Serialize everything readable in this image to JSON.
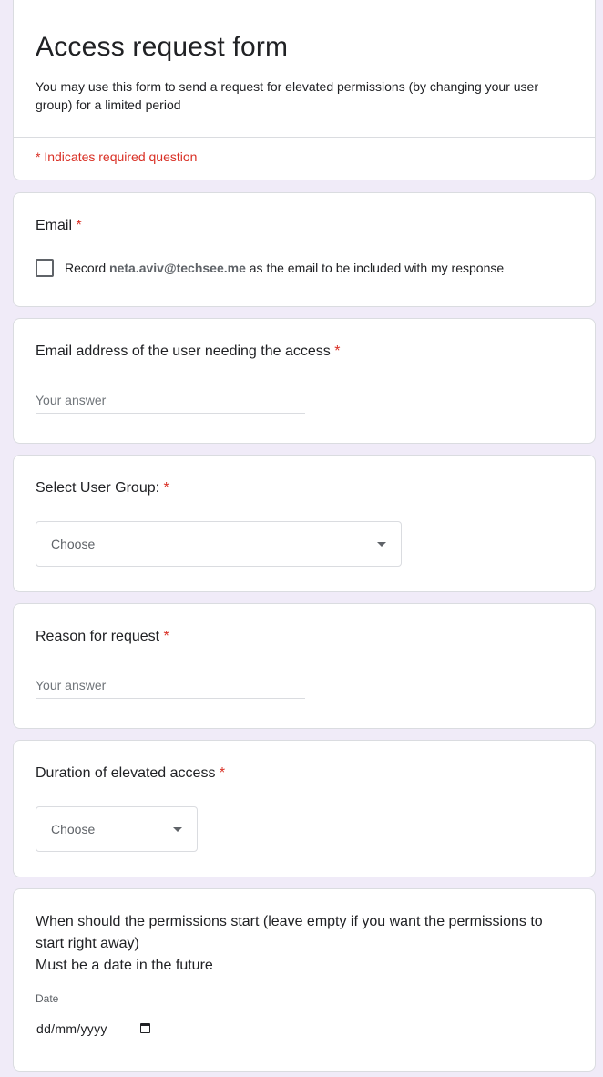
{
  "header": {
    "title": "Access request form",
    "description": "You may use this form to send a request for elevated permissions (by changing your user group) for a limited period",
    "required_note": "* Indicates required question"
  },
  "questions": {
    "email": {
      "title": "Email",
      "required_mark": "*",
      "checkbox_prefix": "Record",
      "checkbox_email": "neta.aviv@techsee.me",
      "checkbox_suffix": "as the email to be included with my response",
      "checked": false
    },
    "user_email": {
      "title": "Email address of the user needing the access",
      "required_mark": "*",
      "placeholder": "Your answer",
      "value": ""
    },
    "user_group": {
      "title": "Select User Group:",
      "required_mark": "*",
      "selected": "Choose"
    },
    "reason": {
      "title": "Reason for request",
      "required_mark": "*",
      "placeholder": "Your answer",
      "value": ""
    },
    "duration": {
      "title": "Duration of elevated access",
      "required_mark": "*",
      "selected": "Choose"
    },
    "start": {
      "title_line1": "When should the permissions start (leave empty if you want the permissions to start right away)",
      "title_line2": "Must be a date in the future",
      "date_label": "Date",
      "date_placeholder": "dd/mm/yyyy"
    }
  },
  "colors": {
    "background": "#f0ebf8",
    "accent": "#673ab7",
    "required": "#d93025"
  },
  "icons": {
    "dropdown": "dropdown-arrow-icon",
    "calendar": "calendar-icon"
  }
}
